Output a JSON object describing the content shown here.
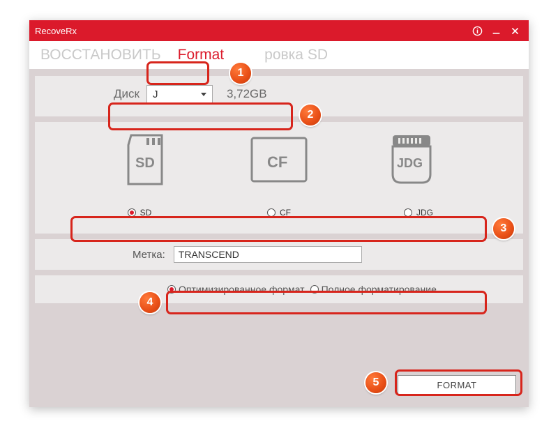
{
  "title": "RecoveRx",
  "tabs": {
    "restore": "ВОССТАНОВИТЬ",
    "format": "Format",
    "unlock": "ровка SD"
  },
  "disk": {
    "label": "Диск",
    "selected": "J",
    "size": "3,72GB"
  },
  "card_types": {
    "options": [
      {
        "key": "SD",
        "label": "SD",
        "selected": true
      },
      {
        "key": "CF",
        "label": "CF",
        "selected": false
      },
      {
        "key": "JDG",
        "label": "JDG",
        "selected": false
      }
    ]
  },
  "volume": {
    "label": "Метка:",
    "value": "TRANSCEND"
  },
  "format_type": {
    "optimized": {
      "label": "Оптимизированное формат",
      "selected": true
    },
    "full": {
      "label": "Полное форматирование",
      "selected": false
    }
  },
  "format_button": "FORMAT",
  "annotations": [
    "1",
    "2",
    "3",
    "4",
    "5"
  ]
}
